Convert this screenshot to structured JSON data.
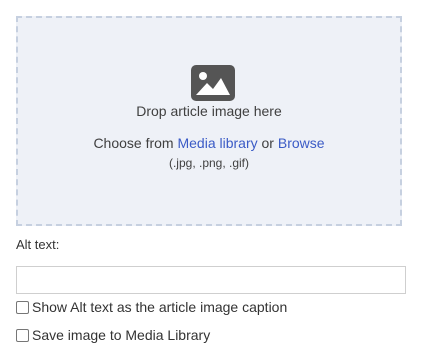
{
  "dropzone": {
    "icon": "image-icon",
    "drop_text": "Drop article image here",
    "choose_prefix": "Choose from",
    "media_library_link": "Media library",
    "or_text": "or",
    "browse_link": "Browse",
    "formats": "(.jpg, .png, .gif)"
  },
  "alt_text": {
    "label": "Alt text:",
    "value": "",
    "placeholder": ""
  },
  "options": {
    "show_caption_label": "Show Alt text as the article image caption",
    "show_caption_checked": false,
    "save_to_library_label": "Save image to Media Library",
    "save_to_library_checked": false
  },
  "colors": {
    "dropzone_bg": "#eef1f7",
    "dropzone_border": "#c6d0e0",
    "link": "#3b5bc6",
    "icon": "#555555"
  }
}
